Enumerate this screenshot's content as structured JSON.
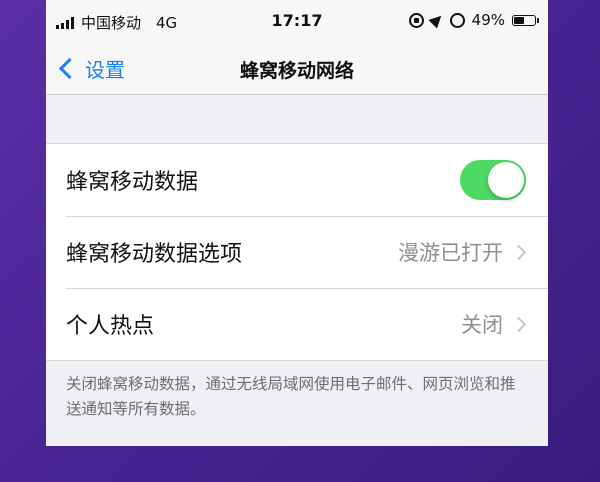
{
  "status_bar": {
    "carrier": "中国移动",
    "network": "4G",
    "time": "17:17",
    "battery_percent": "49%",
    "battery_level": 0.49
  },
  "nav": {
    "back_label": "设置",
    "title": "蜂窝移动网络"
  },
  "rows": [
    {
      "label": "蜂窝移动数据",
      "toggle_on": true
    },
    {
      "label": "蜂窝移动数据选项",
      "value": "漫游已打开"
    },
    {
      "label": "个人热点",
      "value": "关闭"
    }
  ],
  "footnote": "关闭蜂窝移动数据，通过无线局域网使用电子邮件、网页浏览和推送通知等所有数据。",
  "colors": {
    "accent": "#1a7ff0",
    "toggle_on": "#4cd964"
  }
}
